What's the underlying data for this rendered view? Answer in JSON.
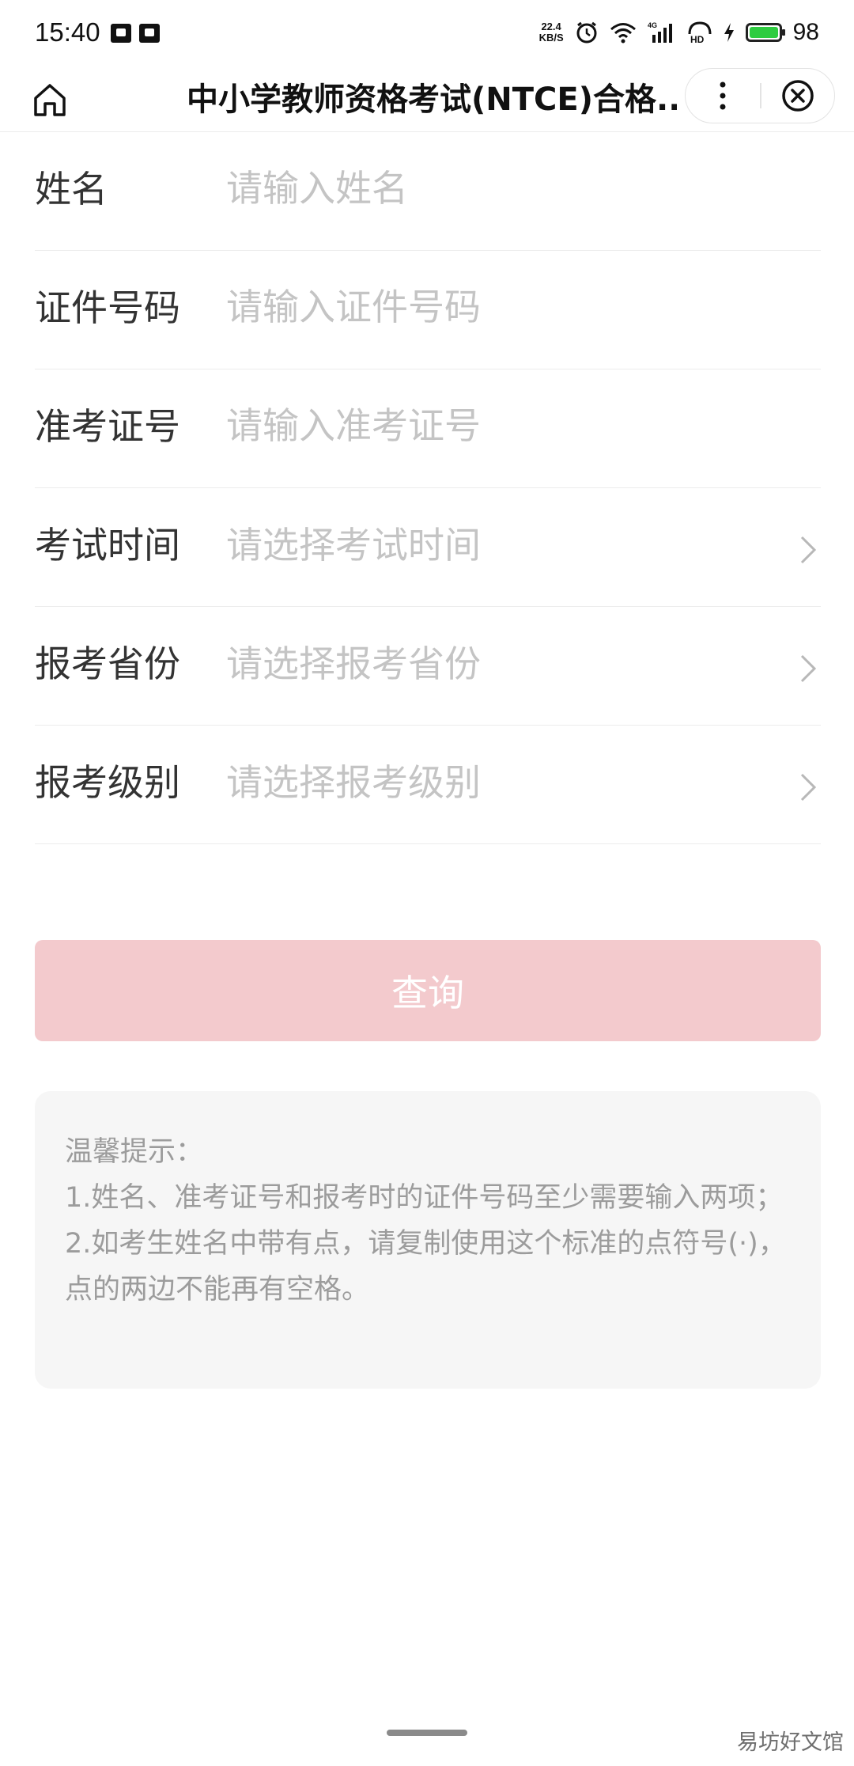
{
  "status_bar": {
    "time": "15:40",
    "net_speed_value": "22.4",
    "net_speed_unit": "KB/S",
    "network_type": "4G",
    "hd_label": "HD",
    "battery_level": "98"
  },
  "nav": {
    "title": "中小学教师资格考试(NTCE)合格..."
  },
  "form": {
    "name": {
      "label": "姓名",
      "placeholder": "请输入姓名"
    },
    "id_number": {
      "label": "证件号码",
      "placeholder": "请输入证件号码"
    },
    "admission_number": {
      "label": "准考证号",
      "placeholder": "请输入准考证号"
    },
    "exam_time": {
      "label": "考试时间",
      "placeholder": "请选择考试时间"
    },
    "province": {
      "label": "报考省份",
      "placeholder": "请选择报考省份"
    },
    "level": {
      "label": "报考级别",
      "placeholder": "请选择报考级别"
    }
  },
  "query_button": {
    "label": "查询"
  },
  "tips": {
    "title": "温馨提示：",
    "line1": "1.姓名、准考证号和报考时的证件号码至少需要输入两项；",
    "line2": "2.如考生姓名中带有点，请复制使用这个标准的点符号(·)，点的两边不能再有空格。"
  },
  "watermark": "易坊好文馆",
  "colors": {
    "button_bg": "#f3cacd",
    "placeholder": "#c4c4c4",
    "tips_bg": "#f6f6f6",
    "battery": "#2ecc40"
  }
}
